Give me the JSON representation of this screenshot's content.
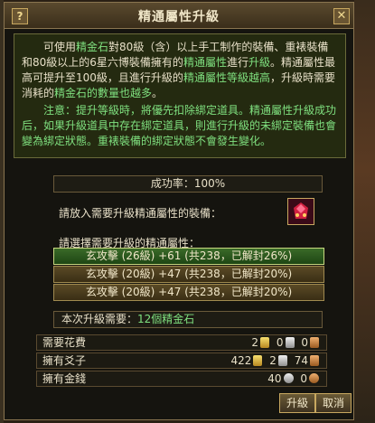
{
  "window": {
    "title": "精通屬性升級",
    "help_label": "?",
    "close_label": "✕"
  },
  "description": {
    "p1_parts": [
      "可使用",
      "精金石",
      "對",
      "80級（含）以上手工制作的裝備、重裱裝備",
      "和",
      "80級以上的6星六博裝備",
      "擁有的",
      "精通屬性",
      "進行",
      "升級",
      "。精通屬性最高可提升至",
      "100級",
      "，且進行升級的",
      "精通屬性等級越高",
      "，升級時需要消耗的",
      "精金石的數量也越多",
      "。"
    ],
    "p2_parts": [
      "注意：提升等級時，將優先扣除綁定道具。精通屬性升級成功后，如果升級道具中存在綁定道具，則進行升級的未綁定裝備也會變為綁定狀態。重裱裝備的綁定狀態不會發生變化。"
    ]
  },
  "success_rate": "成功率：100%",
  "equip_prompt": "請放入需要升級精通屬性的裝備：",
  "equip_slot_icon": "gem-equipment-icon",
  "choose_prompt": "請選擇需要升級的精通屬性：",
  "options": [
    {
      "label": "玄攻擊 (26級) +61 (共238，已解封26%)"
    },
    {
      "label": "玄攻擊 (20級) +47 (共238，已解封20%)"
    },
    {
      "label": "玄攻擊 (20級) +47 (共238，已解封20%)"
    }
  ],
  "need_text": {
    "prefix": "本次升級需要：",
    "value": "12個精金石"
  },
  "costs": {
    "label": "需要花費",
    "gold": "2",
    "silver": "0",
    "copper": "0"
  },
  "owned_ingots": {
    "label": "擁有爻子",
    "gold": "422",
    "silver": "2",
    "copper": "74"
  },
  "owned_money": {
    "label": "擁有金錢",
    "silver": "40",
    "copper": "0"
  },
  "buttons": {
    "upgrade": "升級",
    "cancel": "取消"
  }
}
